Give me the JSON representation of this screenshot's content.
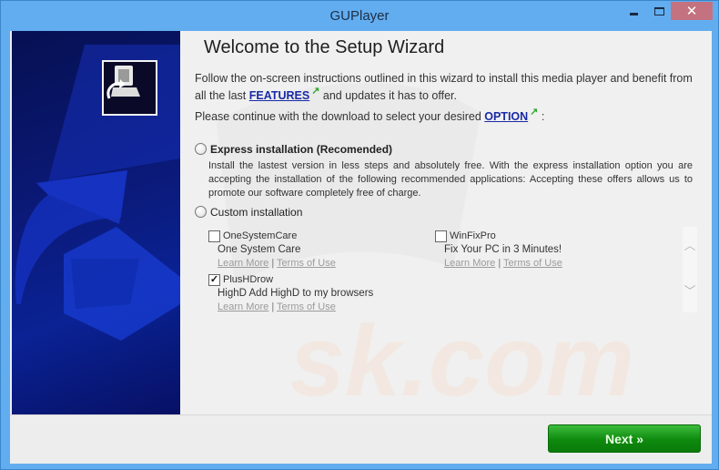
{
  "window": {
    "title": "GUPlayer",
    "controls": {
      "minimize": "minimize",
      "maximize": "maximize",
      "close": "✕"
    }
  },
  "wizard": {
    "heading": "Welcome to the Setup Wizard",
    "intro_part1": "Follow the on-screen instructions outlined in this wizard to install this media player and benefit from all the last ",
    "features_link": "FEATURES",
    "intro_part2": " and updates it has to offer.",
    "continue_text": "Please continue with the download to select your desired ",
    "option_link": "OPTION",
    "continue_suffix": " :",
    "external_link_icon": "↗"
  },
  "installation": {
    "express": {
      "label": "Express installation (Recomended)",
      "selected": false,
      "description": "Install the lastest version in less steps and absolutely free. With the express installation option you are accepting the installation of the following recommended applications: Accepting these offers allows us to promote our software completely free of charge."
    },
    "custom": {
      "label": "Custom installation",
      "selected": false
    }
  },
  "offers": [
    {
      "name": "OneSystemCare",
      "description": "One System Care",
      "checked": false,
      "learn_more": "Learn More",
      "separator": "|",
      "terms": "Terms of Use"
    },
    {
      "name": "WinFixPro",
      "description": "Fix Your PC in 3 Minutes!",
      "checked": false,
      "learn_more": "Learn More",
      "separator": "|",
      "terms": "Terms of Use"
    },
    {
      "name": "PlusHDrow",
      "description": "HighD Add HighD to my browsers",
      "checked": true,
      "learn_more": "Learn More",
      "separator": "|",
      "terms": "Terms of Use"
    }
  ],
  "scroll": {
    "up": "^",
    "down": "v"
  },
  "footer": {
    "next_label": "Next »"
  },
  "colors": {
    "titlebar": "#62adf0",
    "close": "#c4727f",
    "next_button": "#119311",
    "link": "#1a2aa6"
  }
}
